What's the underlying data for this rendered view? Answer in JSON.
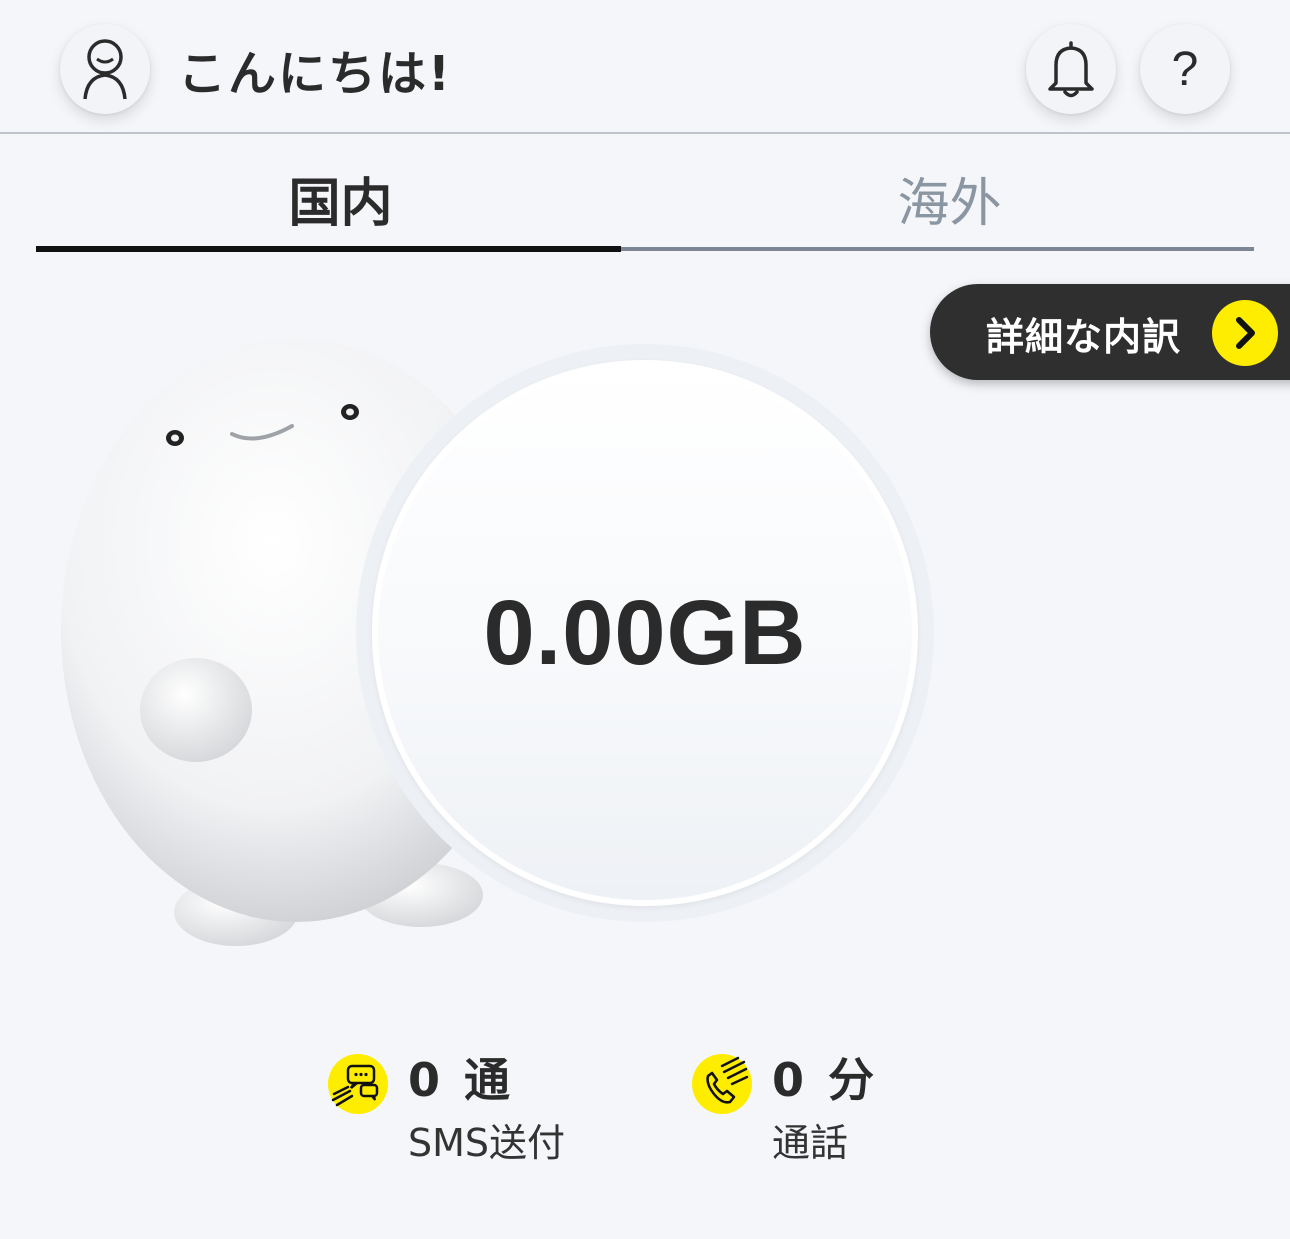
{
  "header": {
    "greeting": "こんにちは!",
    "avatar_icon": "user-outline-icon",
    "bell_icon": "bell-icon",
    "help_label": "?"
  },
  "tabs": [
    {
      "label": "国内",
      "active": true
    },
    {
      "label": "海外",
      "active": false
    }
  ],
  "details_button": {
    "label": "詳細な内訳",
    "icon": "chevron-right-icon"
  },
  "mascot": {
    "icon": "mascot-character"
  },
  "usage": {
    "data_remaining": "0.00GB"
  },
  "stats": {
    "sms": {
      "value": "0 通",
      "label": "SMS送付",
      "icon": "sms-chat-icon"
    },
    "call": {
      "value": "0 分",
      "label": "通話",
      "icon": "phone-call-icon"
    }
  },
  "colors": {
    "accent": "#ffed00",
    "dark": "#2f2f2f",
    "background": "#f4f6fa",
    "inactive_tab": "#8b96a3"
  }
}
